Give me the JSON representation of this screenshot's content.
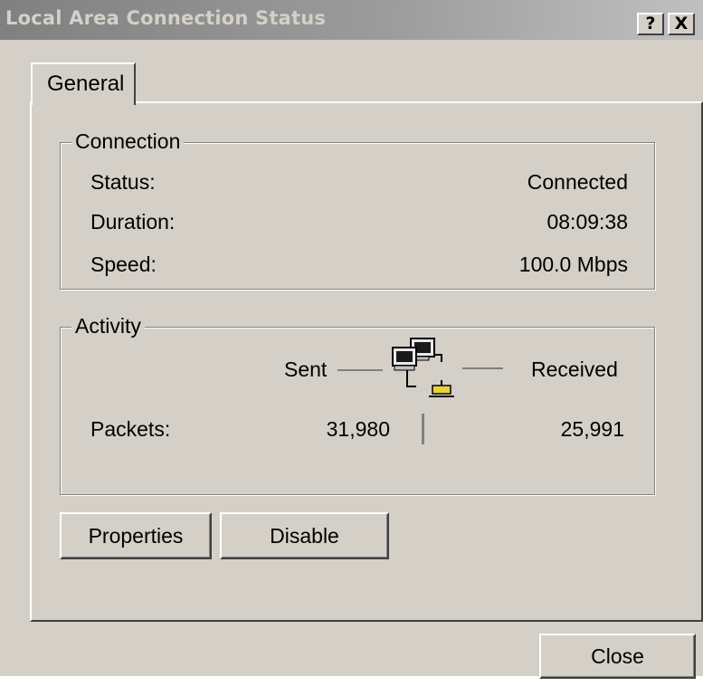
{
  "window": {
    "title": "Local Area Connection Status",
    "help_glyph": "?",
    "close_glyph": "X"
  },
  "tabs": [
    {
      "label": "General",
      "selected": true
    }
  ],
  "connection": {
    "legend": "Connection",
    "rows": [
      {
        "label": "Status:",
        "value": "Connected"
      },
      {
        "label": "Duration:",
        "value": "08:09:38"
      },
      {
        "label": "Speed:",
        "value": "100.0 Mbps"
      }
    ]
  },
  "activity": {
    "legend": "Activity",
    "sent_label": "Sent",
    "received_label": "Received",
    "packets_label": "Packets:",
    "packets_sent": "31,980",
    "packets_received": "25,991",
    "icon": "network-computers-icon"
  },
  "buttons": {
    "properties": "Properties",
    "disable": "Disable",
    "close": "Close"
  },
  "colors": {
    "face": "#d4d0c8",
    "titlebar_inactive": "#808080",
    "shadow": "#808080",
    "highlight": "#ffffff"
  }
}
